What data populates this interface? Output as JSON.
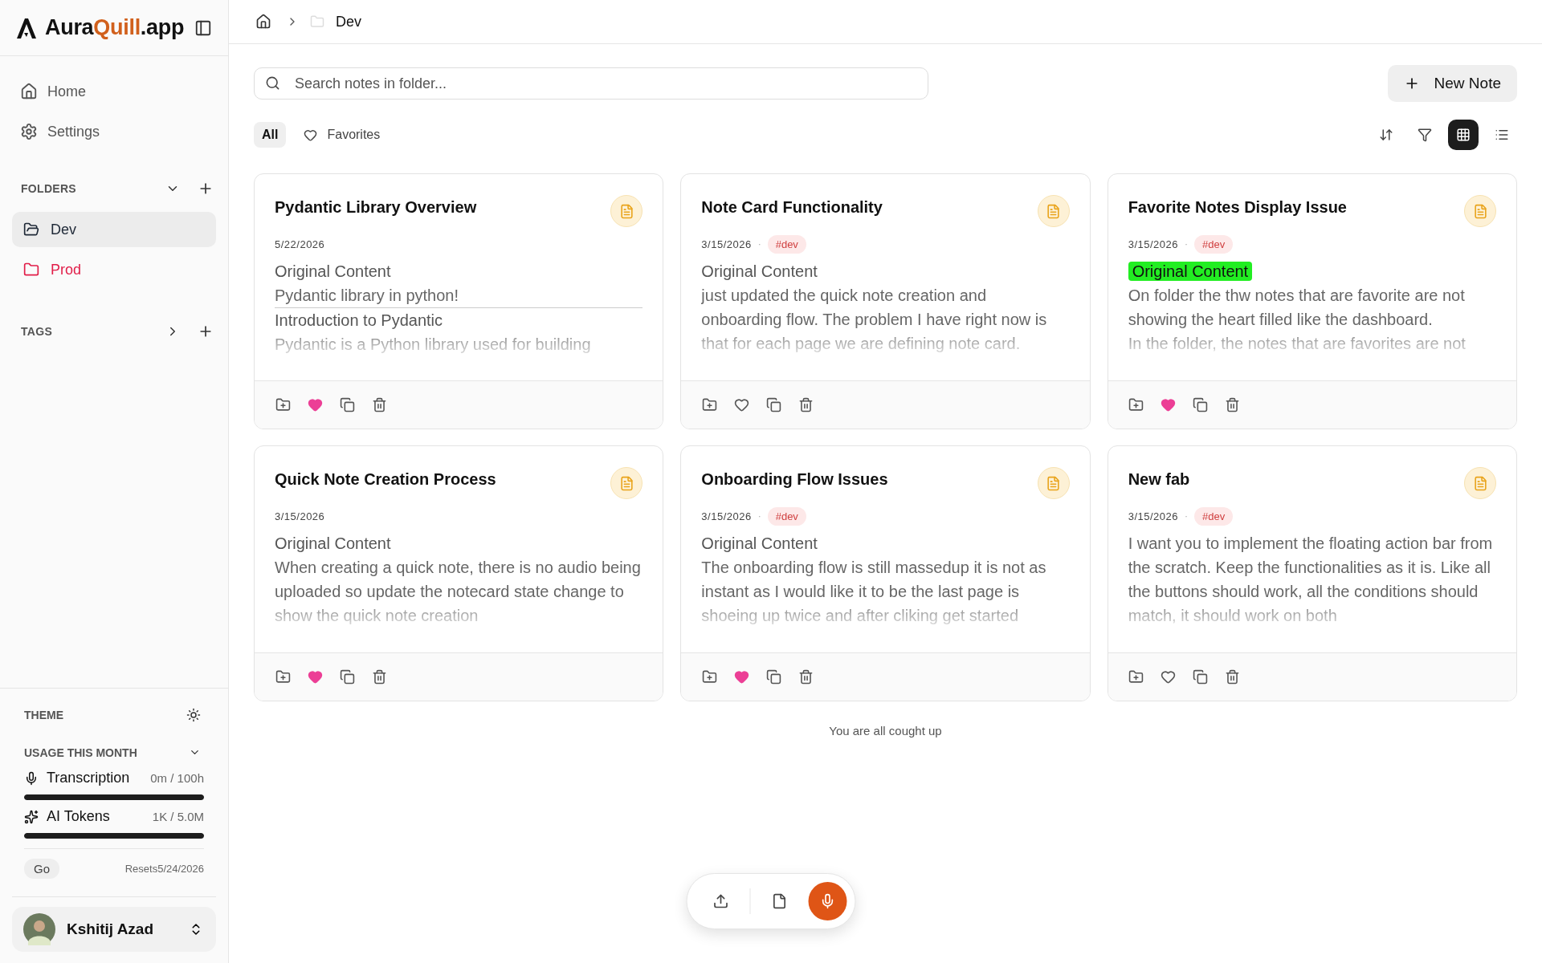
{
  "brand": {
    "parts": [
      {
        "text": "Aura",
        "accent": false
      },
      {
        "text": "Quill",
        "accent": true
      },
      {
        "text": ".app",
        "accent": false
      }
    ]
  },
  "nav": [
    {
      "label": "Home",
      "kind": "home"
    },
    {
      "label": "Settings",
      "kind": "settings"
    }
  ],
  "folders": {
    "title": "FOLDERS",
    "expanded": true,
    "items": [
      {
        "label": "Dev",
        "selected": true,
        "color": "#1f2937"
      },
      {
        "label": "Prod",
        "selected": false,
        "color": "#e11d48"
      }
    ]
  },
  "tags": {
    "title": "TAGS",
    "expanded": false
  },
  "theme": {
    "label": "THEME"
  },
  "usage": {
    "title": "USAGE THIS MONTH",
    "meters": [
      {
        "kind": "mic",
        "label": "Transcription",
        "reading": "0m / 100h",
        "level": 1
      },
      {
        "kind": "sparkles",
        "label": "AI Tokens",
        "reading": "1K / 5.0M",
        "level": 1
      }
    ],
    "plan": "Go",
    "resets": "Resets5/24/2026"
  },
  "user": {
    "name": "Kshitij Azad"
  },
  "breadcrumb": {
    "current": "Dev"
  },
  "search": {
    "placeholder": "Search notes in folder..."
  },
  "new_note": "New Note",
  "filters": [
    {
      "label": "All",
      "kind": "all",
      "selected": true
    },
    {
      "label": "Favorites",
      "kind": "favorites",
      "selected": false
    }
  ],
  "views": [
    {
      "kind": "grid",
      "selected": true
    },
    {
      "kind": "list",
      "selected": false
    }
  ],
  "notes": [
    {
      "title": "Pydantic Library Overview",
      "date": "5/22/2026",
      "favorite": true,
      "content": [
        {
          "kind": "heading",
          "text": "Original Content",
          "highlighted": false
        },
        {
          "kind": "paragraph",
          "text": "Pydantic library in python!"
        },
        {
          "kind": "rule"
        },
        {
          "kind": "heading",
          "text": "Introduction to Pydantic",
          "highlighted": false
        },
        {
          "kind": "paragraph",
          "text": "Pydantic is a Python library used for building"
        }
      ]
    },
    {
      "title": "Note Card Functionality",
      "date": "3/15/2026",
      "separator": "·",
      "tags": [
        "#dev"
      ],
      "favorite": false,
      "content": [
        {
          "kind": "heading",
          "text": "Original Content",
          "highlighted": false
        },
        {
          "kind": "paragraph",
          "text": "just updated the quick note creation and onboarding flow. The problem I have right now is that for each page we are defining note card."
        }
      ]
    },
    {
      "title": "Favorite Notes Display Issue",
      "date": "3/15/2026",
      "separator": "·",
      "tags": [
        "#dev"
      ],
      "favorite": true,
      "content": [
        {
          "kind": "heading",
          "text": "Original Content",
          "highlighted": true
        },
        {
          "kind": "paragraph",
          "text": "On folder the thw notes that are favorite are not showing the heart filled like the dashboard."
        },
        {
          "kind": "paragraph",
          "text": "In the folder, the notes that are favorites are not"
        }
      ]
    },
    {
      "title": "Quick Note Creation Process",
      "date": "3/15/2026",
      "favorite": true,
      "content": [
        {
          "kind": "heading",
          "text": "Original Content",
          "highlighted": false
        },
        {
          "kind": "paragraph",
          "text": "When creating a quick note, there is no audio being uploaded so update the notecard state change to show the quick note creation"
        }
      ]
    },
    {
      "title": "Onboarding Flow Issues",
      "date": "3/15/2026",
      "separator": "·",
      "tags": [
        "#dev"
      ],
      "favorite": true,
      "content": [
        {
          "kind": "heading",
          "text": "Original Content",
          "highlighted": false
        },
        {
          "kind": "paragraph",
          "text": "The onboarding flow is still massedup it is not as instant as I would like it to be the last page is shoeing up twice and after cliking get started"
        }
      ]
    },
    {
      "title": "New fab",
      "date": "3/15/2026",
      "separator": "·",
      "tags": [
        "#dev"
      ],
      "favorite": false,
      "content": [
        {
          "kind": "paragraph",
          "text": "I want you to implement the floating action bar from the scratch. Keep the functionalities as it is. Like all the buttons should work, all the conditions should match, it should work on both"
        }
      ]
    }
  ],
  "end_message": "You are all cought up"
}
